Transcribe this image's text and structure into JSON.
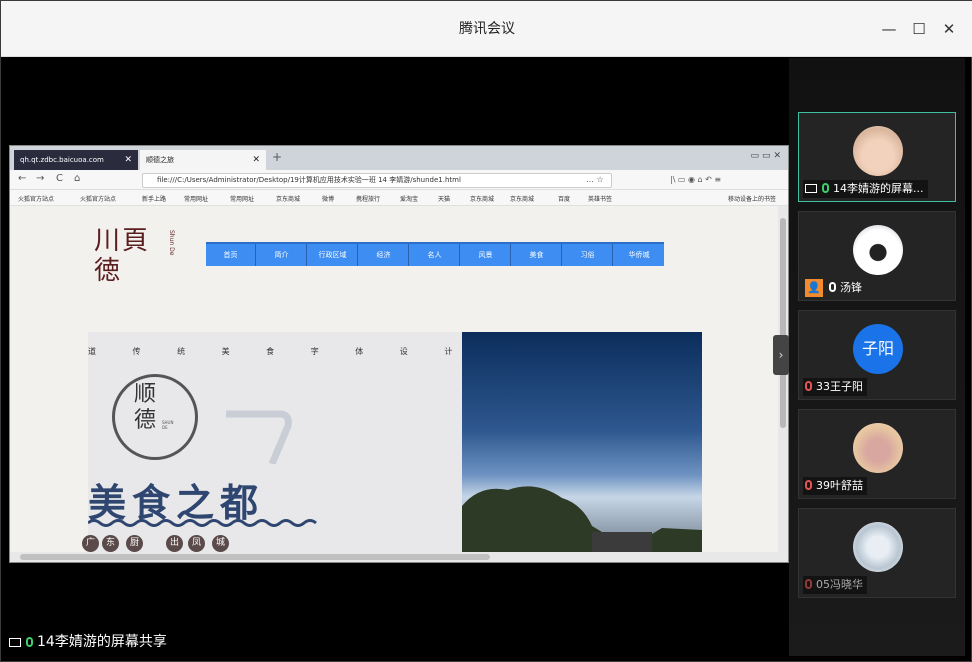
{
  "window": {
    "title": "腾讯会议",
    "buttons": [
      "—",
      "☐",
      "✕"
    ]
  },
  "browser": {
    "tabs": [
      "qh.qt.zdbc.baicuoa.com",
      "顺德之旅"
    ],
    "tab_close": "✕",
    "new_tab": "+",
    "url": "file:///C:/Users/Administrator/Desktop/19计算机应用技术实验一班 14 李婧游/shunde1.html",
    "nav": [
      "←",
      "→",
      "C",
      "⌂"
    ],
    "url_tools": "… ☆",
    "right_tools": "|\\ ▭ ◉ ⌂ ↶ ≡",
    "bookmarks": [
      "火狐官方站点",
      "火狐官方站点",
      "新手上路",
      "常用网址",
      "常用网址",
      "京东商城",
      "微博",
      "携程旅行",
      "爱淘宝",
      "天猫",
      "京东商城",
      "京东商城",
      "百度",
      "英雄书签"
    ],
    "bookmarks_right": "移动设备上的书签"
  },
  "site": {
    "logo_main": "川頁 徳",
    "logo_side": "Shun De",
    "menu": [
      "首页",
      "简介",
      "行政区域",
      "经济",
      "名人",
      "风景",
      "美食",
      "习俗",
      "华侨城"
    ],
    "banner_line": "道 传 统 美 食 字 体 设 计",
    "seal_text": "顺 德",
    "seal_small": "SHUN DE",
    "big_title": "美食之都",
    "circles": [
      "广",
      "东",
      "厨",
      "出",
      "凤",
      "城"
    ]
  },
  "share_status": "14李婧游的屏幕共享",
  "participants": [
    {
      "name": "14李婧游的屏幕...",
      "avatar": "baby-photo",
      "speaking": true,
      "sharing": true
    },
    {
      "name": "汤锋",
      "avatar": "cow-photo",
      "host": true
    },
    {
      "name": "33王子阳",
      "avatar_text": "子阳",
      "muted": true
    },
    {
      "name": "39叶舒喆",
      "avatar": "cartoon-mouse",
      "muted": true
    },
    {
      "name": "05冯晓华",
      "avatar": "sketch-photo",
      "muted": true
    }
  ],
  "colors": {
    "accent": "#3d8df2",
    "active_border": "#3fc1a0",
    "title_bg": "#f5f5f5"
  }
}
